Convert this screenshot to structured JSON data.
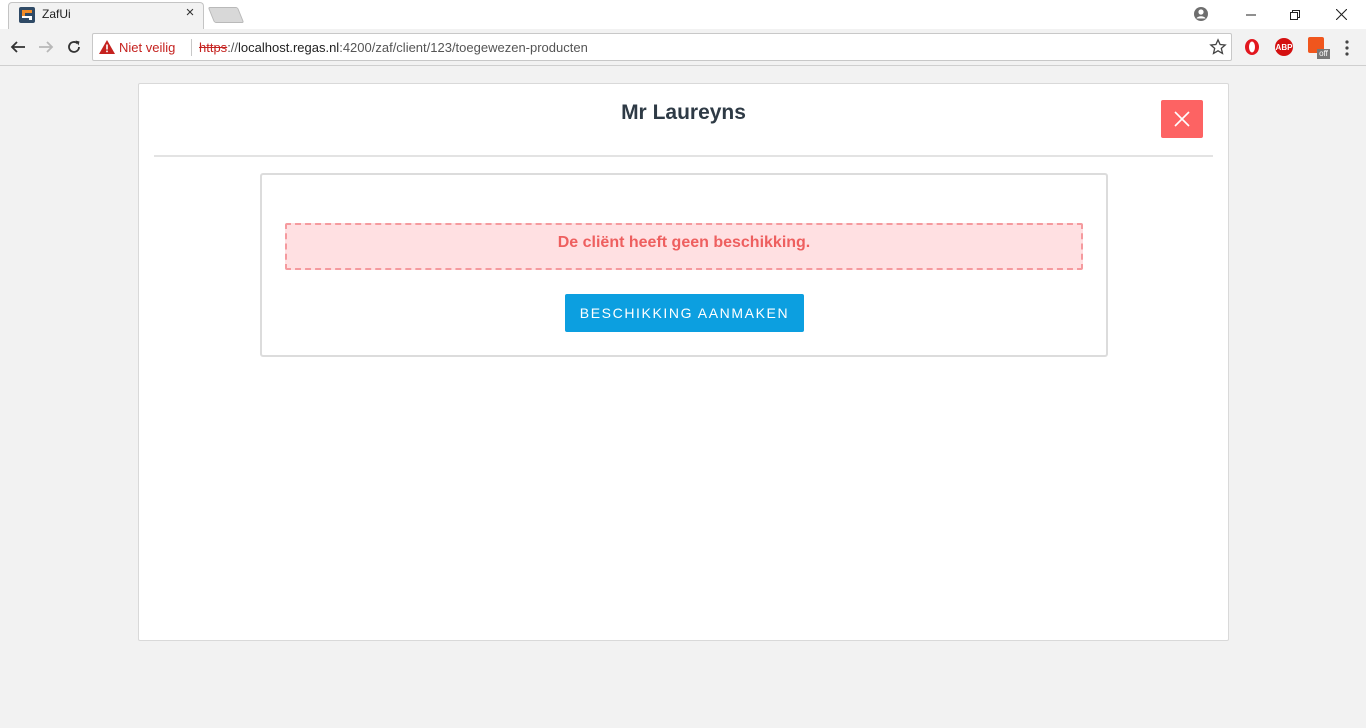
{
  "browser": {
    "tab_title": "ZafUi",
    "tab_close": "×",
    "security_label": "Niet veilig",
    "url_scheme": "https",
    "url_separator": "://",
    "url_host": "localhost.regas.nl",
    "url_path": ":4200/zaf/client/123/toegewezen-producten",
    "abp_label": "ABP",
    "ext_badge": "off"
  },
  "page": {
    "title": "Mr Laureyns",
    "alert_message": "De cliënt heeft geen beschikking.",
    "create_button_label": "BESCHIKKING AANMAKEN"
  },
  "colors": {
    "close_button": "#fd6363",
    "primary_button": "#0c9fe0",
    "alert_background": "#ffe0e2",
    "alert_text": "#ee5f5f"
  }
}
